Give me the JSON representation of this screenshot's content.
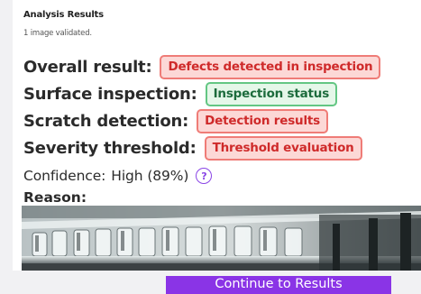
{
  "header": {
    "title": "Analysis Results",
    "subtitle": "1 image validated."
  },
  "results": [
    {
      "label": "Overall result:",
      "value": "Defects detected in inspection",
      "status": "error"
    },
    {
      "label": "Surface inspection:",
      "value": "Inspection status",
      "status": "success"
    },
    {
      "label": "Scratch detection:",
      "value": "Detection results",
      "status": "error"
    },
    {
      "label": "Severity threshold:",
      "value": "Threshold evaluation",
      "status": "error"
    }
  ],
  "confidence": {
    "label": "Confidence:",
    "value": "High (89%)",
    "help_icon": "question-circle-icon"
  },
  "reason": {
    "label": "Reason:"
  },
  "footer": {
    "continue_label": "Continue to Results"
  },
  "colors": {
    "accent": "#8a34e6",
    "error_bg": "#fcd8d6",
    "error_text": "#cf2a2a",
    "success_bg": "#e5f7e9",
    "success_text": "#1c6b3c"
  }
}
